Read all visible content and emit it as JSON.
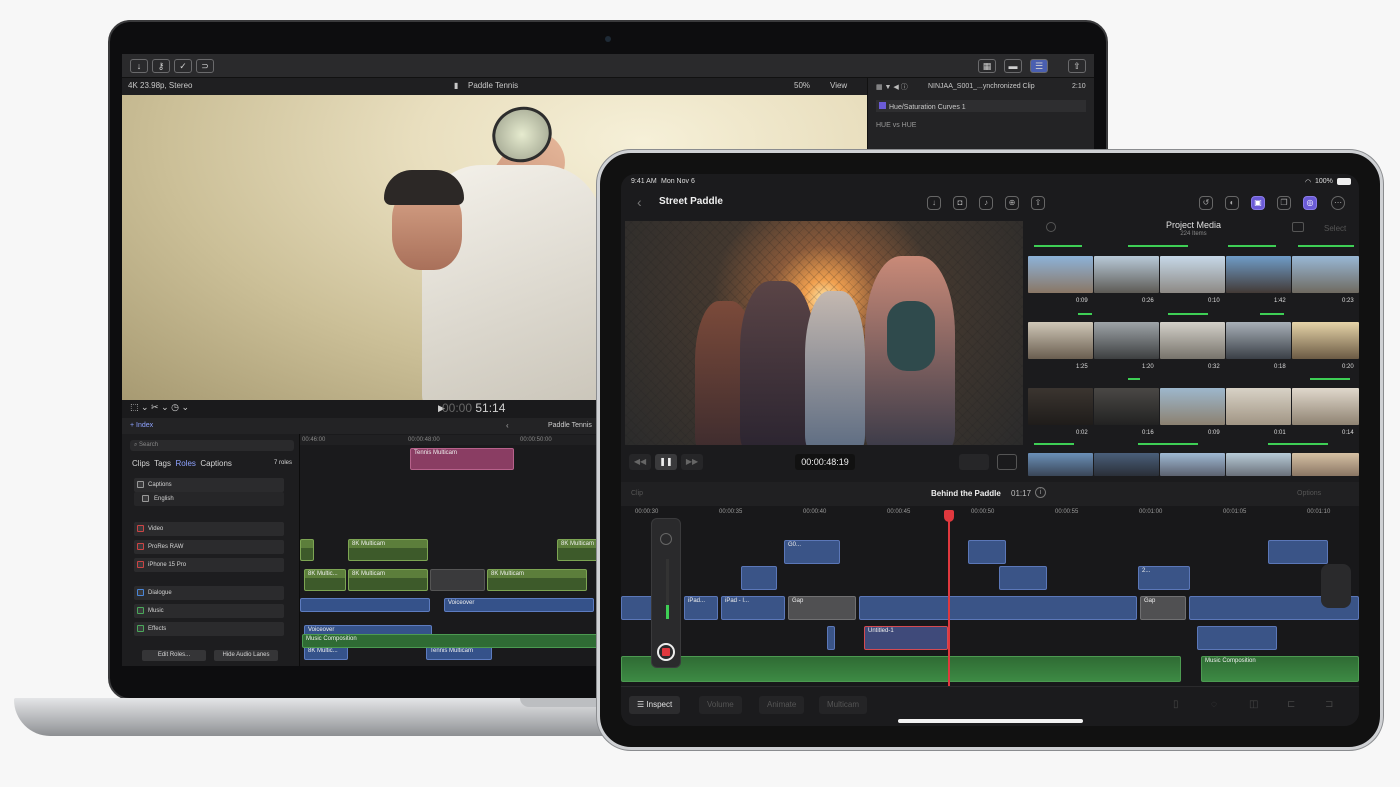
{
  "mac": {
    "viewer": {
      "format": "4K 23.98p, Stereo",
      "title": "Paddle Tennis",
      "zoom": "50%",
      "view": "View"
    },
    "inspector": {
      "clip": "NINJAA_S001_...ynchronized Clip",
      "duration": "2:10",
      "effect": "Hue/Saturation Curves 1",
      "curve": "HUE vs HUE"
    },
    "transport": {
      "timecode_dim": "00:00",
      "timecode": "51:14"
    },
    "browser": {
      "index_label": "Index",
      "search_placeholder": "Search",
      "tabs": [
        "Clips",
        "Tags",
        "Roles",
        "Captions"
      ],
      "count": "7 roles",
      "roles": [
        "Captions",
        "English",
        "Video",
        "ProRes RAW",
        "iPhone 15 Pro",
        "Dialogue",
        "Music",
        "Effects"
      ],
      "edit_roles": "Edit Roles...",
      "hide_lanes": "Hide Audio Lanes"
    },
    "timeline": {
      "title": "Paddle Tennis",
      "ruler": [
        "00:46:00",
        "00:00:48:00",
        "00:00:50:00"
      ],
      "clips": {
        "tennis_multicam": "Tennis Multicam",
        "c8k1": "8K Multicam",
        "c8k2": "8K Multicam",
        "c8k3": "8K Multic...",
        "c8k4": "8K Multicam",
        "c8k5": "8K Multicam",
        "voiceover1": "Voiceover",
        "voiceover2": "Voiceover",
        "c8k6": "8K Multic...",
        "tennis_multicam2": "Tennis Multicam",
        "music": "Music Composition"
      }
    }
  },
  "ipad": {
    "status": {
      "time": "9:41 AM",
      "date": "Mon Nov 6",
      "battery": "100%"
    },
    "title": "Street Paddle",
    "timecode": "00:00:48:19",
    "media": {
      "title": "Project Media",
      "count": "224 Items",
      "select": "Select",
      "durations": [
        "0:09",
        "0:26",
        "0:10",
        "1:42",
        "0:23",
        "1:25",
        "1:20",
        "0:32",
        "0:18",
        "0:20",
        "0:02",
        "0:16",
        "0:09",
        "0:01",
        "0:14"
      ]
    },
    "project": {
      "name": "Behind the Paddle",
      "duration": "01:17",
      "clip": "Clip",
      "options": "Options"
    },
    "ruler": [
      "00:00:30",
      "00:00:35",
      "00:00:40",
      "00:00:45",
      "00:00:50",
      "00:00:55",
      "00:01:00",
      "00:01:05",
      "00:01:10"
    ],
    "clips": {
      "ipad1": "iPad...",
      "ipad2": "iPad - I...",
      "gap1": "Gap",
      "gap2": "Gap",
      "untitled": "Untitled-1",
      "music": "Music Composition",
      "c1": "G0...",
      "c2": "2..."
    },
    "bottom": {
      "inspect": "Inspect",
      "volume": "Volume",
      "animate": "Animate",
      "multicam": "Multicam"
    }
  },
  "colors": {
    "accent": "#6b5bd6",
    "green": "#3ecf55",
    "playhead": "#e0383e"
  }
}
